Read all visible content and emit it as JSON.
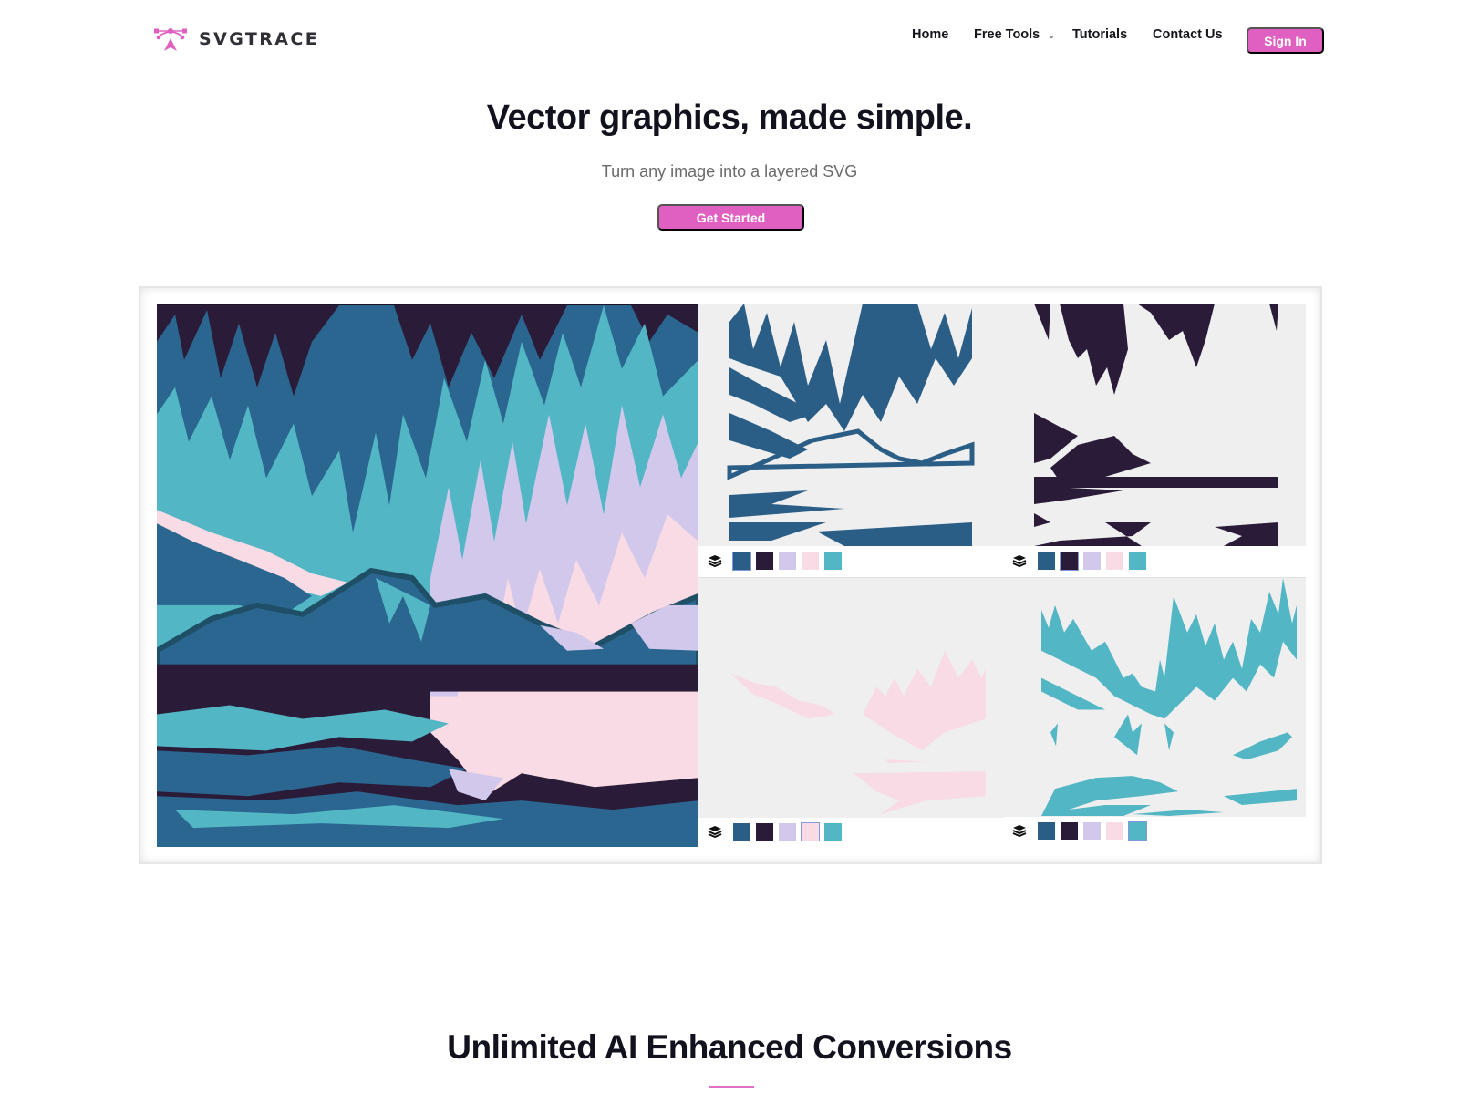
{
  "brand": {
    "name": "SVGTRACE",
    "logo_icon": "bezier-pen-icon",
    "accent_color": "#e060c1"
  },
  "nav": {
    "items": [
      {
        "label": "Home"
      },
      {
        "label": "Free Tools",
        "has_dropdown": true,
        "icon": "chevron-down-icon"
      },
      {
        "label": "Tutorials"
      },
      {
        "label": "Contact Us"
      }
    ],
    "sign_in_label": "Sign In"
  },
  "hero": {
    "title": "Vector graphics, made simple.",
    "subtitle": "Turn any image into a layered SVG",
    "cta_label": "Get Started"
  },
  "showcase": {
    "palette": [
      {
        "name": "dark-blue",
        "hex": "#2b5e86"
      },
      {
        "name": "deep-purple",
        "hex": "#2a1c38"
      },
      {
        "name": "lavender",
        "hex": "#d2c8ec"
      },
      {
        "name": "pink",
        "hex": "#f8dbe4"
      },
      {
        "name": "teal",
        "hex": "#52b6c4"
      }
    ],
    "panels": [
      {
        "layer": "dark-blue",
        "selected_swatch": 0,
        "icon": "layers-icon"
      },
      {
        "layer": "deep-purple",
        "selected_swatch": 1,
        "icon": "layers-icon"
      },
      {
        "layer": "pink",
        "selected_swatch": 3,
        "icon": "layers-icon"
      },
      {
        "layer": "teal",
        "selected_swatch": 4,
        "icon": "layers-icon"
      }
    ]
  },
  "section2": {
    "title": "Unlimited AI Enhanced Conversions"
  }
}
